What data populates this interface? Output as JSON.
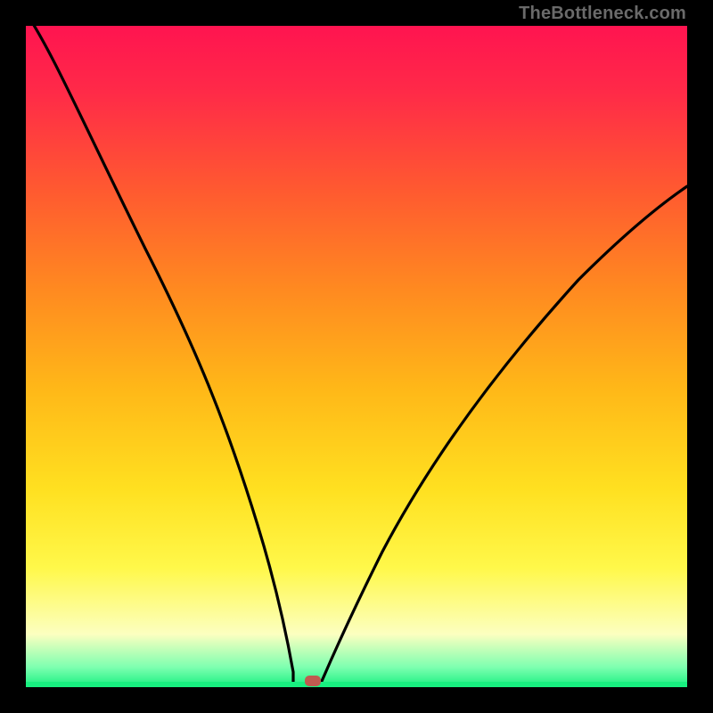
{
  "watermark": "TheBottleneck.com",
  "colors": {
    "background": "#000000",
    "gradient_top": "#ff1450",
    "gradient_mid": "#ffe020",
    "gradient_bottom": "#18f080",
    "curve": "#000000",
    "marker": "#c05a50"
  },
  "chart_data": {
    "type": "line",
    "title": "",
    "xlabel": "",
    "ylabel": "",
    "xlim": [
      0,
      100
    ],
    "ylim": [
      0,
      100
    ],
    "x": [
      0,
      2,
      6,
      12,
      18,
      24,
      30,
      34,
      38,
      40,
      42,
      44,
      48,
      54,
      62,
      72,
      84,
      100
    ],
    "values": [
      102,
      100,
      92,
      80,
      67,
      53,
      37,
      22,
      8,
      2,
      0,
      3,
      10,
      20,
      32,
      45,
      58,
      73
    ],
    "marker": {
      "x": 42,
      "y": 0
    },
    "annotations": [
      "TheBottleneck.com"
    ]
  }
}
